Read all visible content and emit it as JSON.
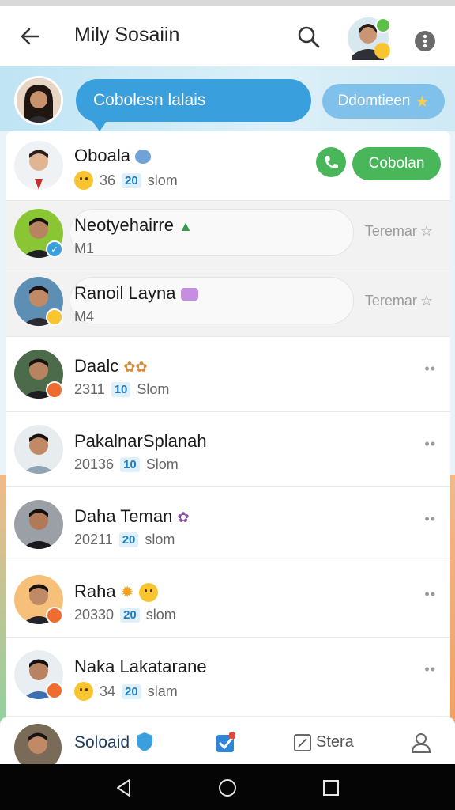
{
  "header": {
    "title": "Mily Sosaiin",
    "icons": [
      "back-arrow-icon",
      "search-icon",
      "profile-avatar",
      "more-icon"
    ]
  },
  "composer": {
    "bubble_text": "Cobolesn lalais",
    "pill_label": "Ddomtieen"
  },
  "conversations": [
    {
      "name": "Oboala",
      "meta_a": "36",
      "meta_num": "20",
      "meta_b": "slom",
      "action": "Cobolan",
      "colors": {
        "avatar": "#e9c8a6"
      }
    },
    {
      "name": "Neotyehairre",
      "meta_a": "M1",
      "action": "Teremar"
    },
    {
      "name": "Ranoil Layna",
      "meta_a": "M4",
      "action": "Teremar"
    },
    {
      "name": "Daalc",
      "meta_a": "2311",
      "meta_num": "10",
      "meta_b": "Slom"
    },
    {
      "name": "PakalnarSplanah",
      "meta_a": "20136",
      "meta_num": "10",
      "meta_b": "Slom"
    },
    {
      "name": "Daha Teman",
      "meta_a": "20211",
      "meta_num": "20",
      "meta_b": "slom"
    },
    {
      "name": "Raha",
      "meta_a": "20330",
      "meta_num": "20",
      "meta_b": "slom"
    },
    {
      "name": "Naka Lakatarane",
      "meta_a": "34",
      "meta_num": "20",
      "meta_b": "slam"
    }
  ],
  "more_label": "••",
  "tabbar": {
    "self_label": "Soloaid",
    "stera_label": "Stera"
  },
  "colors": {
    "accent_blue": "#3aa0dd",
    "accent_green": "#49b65a",
    "badge_orange": "#ef6c2f"
  }
}
